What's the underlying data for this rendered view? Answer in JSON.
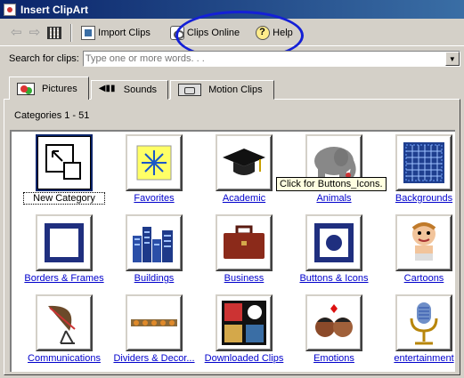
{
  "window": {
    "title": "Insert ClipArt"
  },
  "toolbar": {
    "import_label": "Import Clips",
    "online_label": "Clips Online",
    "help_label": "Help",
    "icons": [
      "back-arrow-icon",
      "forward-arrow-icon",
      "all-categories-icon",
      "import-clips-icon",
      "clips-online-icon",
      "help-icon"
    ]
  },
  "search": {
    "label": "Search for clips:",
    "placeholder": "Type one or more words. . ."
  },
  "tabs": [
    {
      "label": "Pictures",
      "active": true
    },
    {
      "label": "Sounds",
      "active": false
    },
    {
      "label": "Motion Clips",
      "active": false
    }
  ],
  "panel": {
    "category_count": "Categories 1 - 51"
  },
  "categories": [
    {
      "label": "New Category"
    },
    {
      "label": "Favorites"
    },
    {
      "label": "Academic"
    },
    {
      "label": "Animals"
    },
    {
      "label": "Backgrounds"
    },
    {
      "label": "Borders & Frames"
    },
    {
      "label": "Buildings"
    },
    {
      "label": "Business"
    },
    {
      "label": "Buttons & Icons"
    },
    {
      "label": "Cartoons"
    },
    {
      "label": "Communications"
    },
    {
      "label": "Dividers & Decor..."
    },
    {
      "label": "Downloaded Clips"
    },
    {
      "label": "Emotions"
    },
    {
      "label": "entertainment"
    }
  ],
  "tooltip": {
    "text": "Click for Buttons_Icons."
  },
  "colors": {
    "titlebar": "#0a246a",
    "highlight_ellipse": "#1420d6",
    "link": "#0000cc",
    "tooltip_bg": "#ffffe1"
  }
}
